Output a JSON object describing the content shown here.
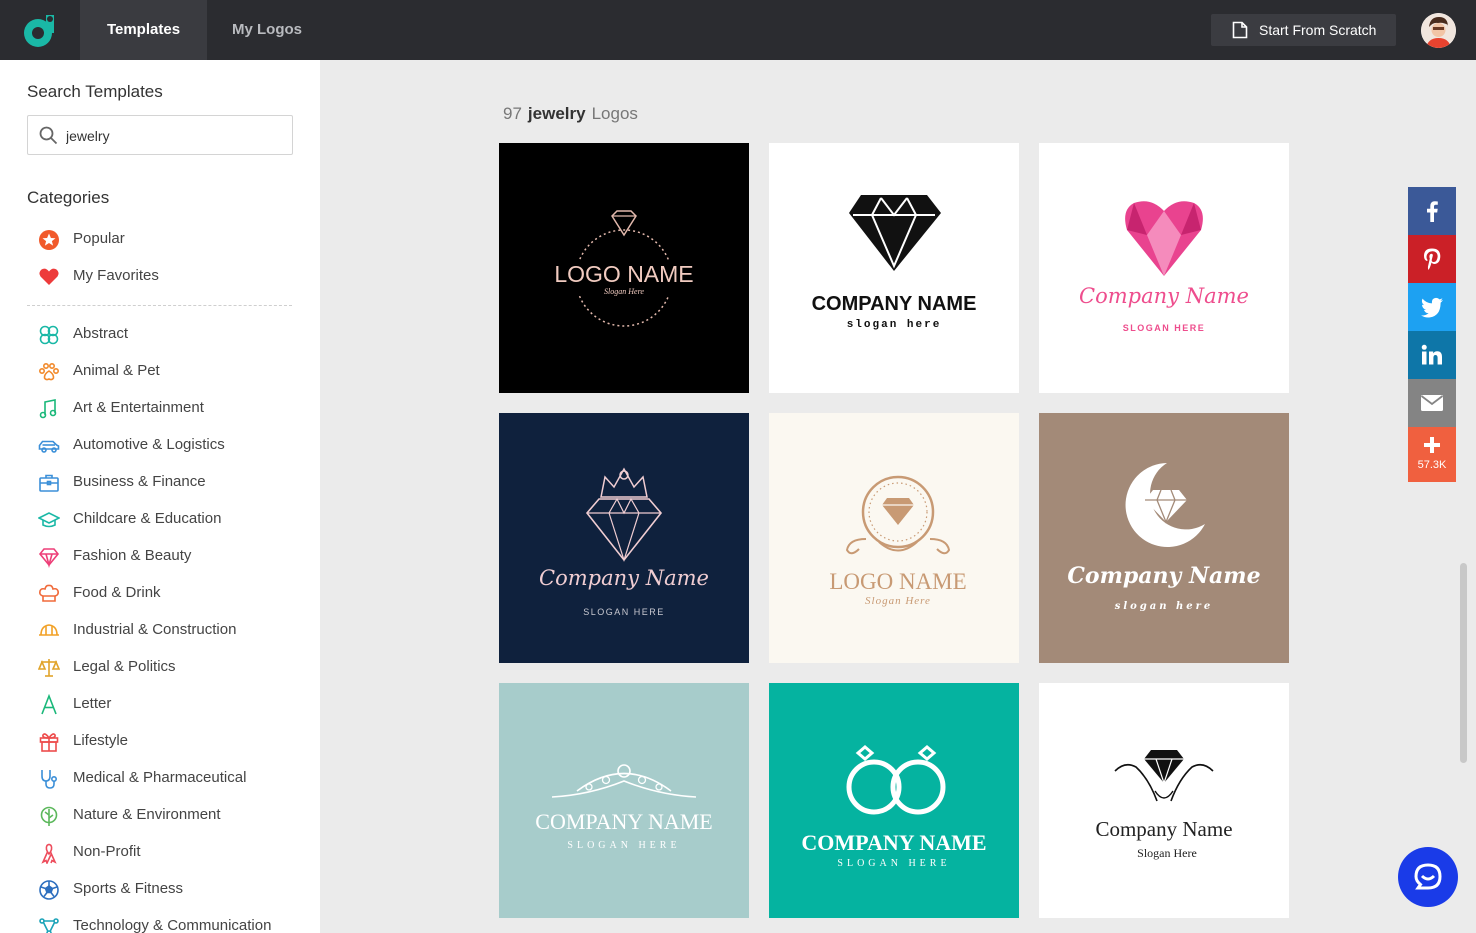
{
  "topbar": {
    "tabs": [
      {
        "label": "Templates",
        "active": true
      },
      {
        "label": "My Logos",
        "active": false
      }
    ],
    "start_button_label": "Start From Scratch",
    "brand_color": "#1ab8a6"
  },
  "sidebar": {
    "search_title": "Search Templates",
    "search_value": "jewelry",
    "categories_title": "Categories",
    "top_items": [
      {
        "label": "Popular",
        "icon": "star-badge-icon"
      },
      {
        "label": "My Favorites",
        "icon": "heart-icon"
      }
    ],
    "items": [
      {
        "label": "Abstract",
        "icon": "abstract-icon"
      },
      {
        "label": "Animal & Pet",
        "icon": "paw-icon"
      },
      {
        "label": "Art & Entertainment",
        "icon": "music-note-icon"
      },
      {
        "label": "Automotive & Logistics",
        "icon": "car-icon"
      },
      {
        "label": "Business & Finance",
        "icon": "briefcase-icon"
      },
      {
        "label": "Childcare & Education",
        "icon": "graduation-cap-icon"
      },
      {
        "label": "Fashion & Beauty",
        "icon": "diamond-icon"
      },
      {
        "label": "Food & Drink",
        "icon": "chef-hat-icon"
      },
      {
        "label": "Industrial & Construction",
        "icon": "hard-hat-icon"
      },
      {
        "label": "Legal & Politics",
        "icon": "scales-icon"
      },
      {
        "label": "Letter",
        "icon": "letter-a-icon"
      },
      {
        "label": "Lifestyle",
        "icon": "gift-icon"
      },
      {
        "label": "Medical & Pharmaceutical",
        "icon": "stethoscope-icon"
      },
      {
        "label": "Nature & Environment",
        "icon": "leaf-icon"
      },
      {
        "label": "Non-Profit",
        "icon": "ribbon-icon"
      },
      {
        "label": "Sports & Fitness",
        "icon": "soccer-ball-icon"
      },
      {
        "label": "Technology & Communication",
        "icon": "network-icon"
      }
    ]
  },
  "results": {
    "count": "97",
    "keyword": "jewelry",
    "suffix": "Logos"
  },
  "templates": [
    {
      "name": "LOGO NAME",
      "slogan": "Slogan Here",
      "bg": "#000000"
    },
    {
      "name": "COMPANY NAME",
      "slogan": "slogan here",
      "bg": "#ffffff"
    },
    {
      "name": "Company Name",
      "slogan": "SLOGAN HERE",
      "bg": "#ffffff"
    },
    {
      "name": "Company Name",
      "slogan": "SLOGAN HERE",
      "bg": "#0f213d"
    },
    {
      "name": "LOGO NAME",
      "slogan": "Slogan Here",
      "bg": "#fbf8f1"
    },
    {
      "name": "Company Name",
      "slogan": "slogan here",
      "bg": "#a38a78"
    },
    {
      "name": "COMPANY NAME",
      "slogan": "SLOGAN HERE",
      "bg": "#a7cccb"
    },
    {
      "name": "COMPANY NAME",
      "slogan": "SLOGAN HERE",
      "bg": "#05b3a0"
    },
    {
      "name": "Company Name",
      "slogan": "Slogan Here",
      "bg": "#ffffff"
    }
  ],
  "social": {
    "buttons": [
      {
        "icon": "facebook-icon",
        "color": "#3b5998"
      },
      {
        "icon": "pinterest-icon",
        "color": "#cb2027"
      },
      {
        "icon": "twitter-icon",
        "color": "#1da1f2"
      },
      {
        "icon": "linkedin-icon",
        "color": "#0e76a8"
      },
      {
        "icon": "email-icon",
        "color": "#848484"
      },
      {
        "icon": "share-plus-icon",
        "color": "#f0603f"
      }
    ],
    "share_count": "57.3K"
  }
}
